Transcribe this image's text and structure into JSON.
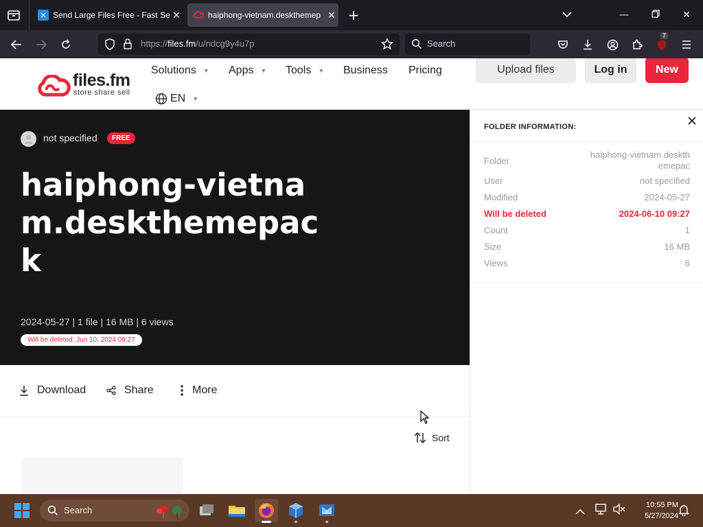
{
  "browser": {
    "tabs": [
      {
        "title": "Send Large Files Free - Fast Sec",
        "active": false
      },
      {
        "title": "haiphong-vietnam.deskthemep",
        "active": true
      }
    ],
    "url": {
      "scheme": "https://",
      "host": "files.fm",
      "path": "/u/ndcg9y4u7p"
    },
    "search_placeholder": "Search",
    "extension_badge": "7"
  },
  "site": {
    "logo_name": "files.fm",
    "logo_tagline": "store share sell",
    "nav": {
      "solutions": "Solutions",
      "apps": "Apps",
      "tools": "Tools",
      "business": "Business",
      "pricing": "Pricing",
      "language": "EN"
    },
    "buttons": {
      "upload": "Upload files",
      "login": "Log in",
      "new": "New"
    },
    "accent": "#e8273a"
  },
  "folder": {
    "owner": "not specified",
    "plan_badge": "FREE",
    "title": "haiphong-vietnam.deskthemepack",
    "meta": "2024-05-27 | 1 file | 16 MB | 6 views",
    "delete_notice": "Will be deleted: Jun 10, 2024 09:27"
  },
  "actions": {
    "download": "Download",
    "share": "Share",
    "more": "More",
    "sort": "Sort"
  },
  "info_panel": {
    "title": "FOLDER INFORMATION:",
    "rows": [
      {
        "key": "Folder",
        "value": "haiphong-vietnam.deskthemepac"
      },
      {
        "key": "User",
        "value": "not specified"
      },
      {
        "key": "Modified",
        "value": "2024-05-27"
      },
      {
        "key": "Will be deleted",
        "value": "2024-06-10 09:27"
      },
      {
        "key": "Count",
        "value": "1"
      },
      {
        "key": "Size",
        "value": "16 MB"
      },
      {
        "key": "Views",
        "value": "6"
      }
    ]
  },
  "taskbar": {
    "search_placeholder": "Search",
    "time": "10:55 PM",
    "date": "5/27/2024"
  }
}
